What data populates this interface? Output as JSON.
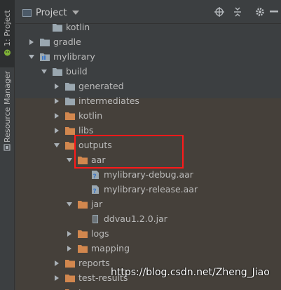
{
  "sidebar": {
    "project_tab": "1: Project",
    "resource_tab": "Resource Manager"
  },
  "header": {
    "title": "Project",
    "buttons": [
      "target-icon",
      "collapse-icon",
      "gear-icon",
      "hide-icon"
    ]
  },
  "tree": [
    {
      "name": "kotlin",
      "level": 2,
      "arrow": "none",
      "icon": "folder-gray"
    },
    {
      "name": "gradle",
      "level": 1,
      "arrow": "right",
      "icon": "folder-gray"
    },
    {
      "name": "mylibrary",
      "level": 1,
      "arrow": "down",
      "icon": "folder-module"
    },
    {
      "name": "build",
      "level": 2,
      "arrow": "down",
      "icon": "folder-gray"
    },
    {
      "name": "generated",
      "level": 3,
      "arrow": "right",
      "icon": "folder-gray"
    },
    {
      "name": "intermediates",
      "level": 3,
      "arrow": "right",
      "icon": "folder-gray"
    },
    {
      "name": "kotlin",
      "level": 3,
      "arrow": "right",
      "icon": "folder-orange"
    },
    {
      "name": "libs",
      "level": 3,
      "arrow": "right",
      "icon": "folder-orange"
    },
    {
      "name": "outputs",
      "level": 3,
      "arrow": "down",
      "icon": "folder-orange"
    },
    {
      "name": "aar",
      "level": 4,
      "arrow": "down",
      "icon": "folder-orange"
    },
    {
      "name": "mylibrary-debug.aar",
      "level": 5,
      "arrow": "none",
      "icon": "file-unknown"
    },
    {
      "name": "mylibrary-release.aar",
      "level": 5,
      "arrow": "none",
      "icon": "file-unknown"
    },
    {
      "name": "jar",
      "level": 4,
      "arrow": "down",
      "icon": "folder-orange"
    },
    {
      "name": "ddvau1.2.0.jar",
      "level": 5,
      "arrow": "none",
      "icon": "file-jar"
    },
    {
      "name": "logs",
      "level": 4,
      "arrow": "right",
      "icon": "folder-orange"
    },
    {
      "name": "mapping",
      "level": 4,
      "arrow": "right",
      "icon": "folder-orange"
    },
    {
      "name": "reports",
      "level": 3,
      "arrow": "right",
      "icon": "folder-orange"
    },
    {
      "name": "test-results",
      "level": 3,
      "arrow": "right",
      "icon": "folder-orange"
    },
    {
      "name": "tmp",
      "level": 3,
      "arrow": "right",
      "icon": "folder-orange"
    }
  ],
  "watermark": "https://blog.csdn.net/Zheng_Jiao",
  "colors": {
    "panel_bg": "#3c3f41",
    "excluded_bg": "#45403a",
    "highlight_border": "#ff1a1a",
    "folder_gray": "#9aa7b0",
    "folder_orange": "#d2874e"
  }
}
